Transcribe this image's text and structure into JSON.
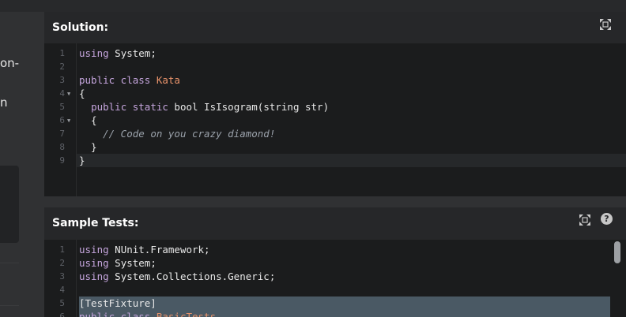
{
  "left": {
    "text1": "on-",
    "text2": "n"
  },
  "solution": {
    "title": "Solution:",
    "expand_icon": "expand-icon",
    "lines": [
      {
        "n": "1",
        "fold": false,
        "segs": [
          {
            "c": "kw",
            "t": "using"
          },
          {
            "c": "",
            "t": " System;"
          }
        ]
      },
      {
        "n": "2",
        "fold": false,
        "segs": []
      },
      {
        "n": "3",
        "fold": false,
        "segs": [
          {
            "c": "kw",
            "t": "public class"
          },
          {
            "c": "",
            "t": " "
          },
          {
            "c": "ty",
            "t": "Kata"
          }
        ]
      },
      {
        "n": "4",
        "fold": true,
        "segs": [
          {
            "c": "",
            "t": "{"
          }
        ]
      },
      {
        "n": "5",
        "fold": false,
        "segs": [
          {
            "c": "",
            "t": "  "
          },
          {
            "c": "kw",
            "t": "public static"
          },
          {
            "c": "",
            "t": " bool IsIsogram(string str)"
          }
        ]
      },
      {
        "n": "6",
        "fold": true,
        "segs": [
          {
            "c": "",
            "t": "  {"
          }
        ]
      },
      {
        "n": "7",
        "fold": false,
        "segs": [
          {
            "c": "",
            "t": "    "
          },
          {
            "c": "cm",
            "t": "// Code on you crazy diamond!"
          }
        ]
      },
      {
        "n": "8",
        "fold": false,
        "segs": [
          {
            "c": "",
            "t": "  }"
          }
        ]
      },
      {
        "n": "9",
        "fold": false,
        "segs": [
          {
            "c": "",
            "t": "}"
          }
        ]
      }
    ]
  },
  "tests": {
    "title": "Sample Tests:",
    "expand_icon": "expand-icon",
    "help_label": "?",
    "lines": [
      {
        "n": "1",
        "fold": false,
        "segs": [
          {
            "c": "kw",
            "t": "using"
          },
          {
            "c": "",
            "t": " NUnit.Framework;"
          }
        ]
      },
      {
        "n": "2",
        "fold": false,
        "segs": [
          {
            "c": "kw",
            "t": "using"
          },
          {
            "c": "",
            "t": " System;"
          }
        ]
      },
      {
        "n": "3",
        "fold": false,
        "segs": [
          {
            "c": "kw",
            "t": "using"
          },
          {
            "c": "",
            "t": " System.Collections.Generic;"
          }
        ]
      },
      {
        "n": "4",
        "fold": false,
        "segs": []
      },
      {
        "n": "5",
        "fold": false,
        "segs": [
          {
            "c": "",
            "t": "[TestFixture]"
          }
        ]
      },
      {
        "n": "6",
        "fold": false,
        "segs": [
          {
            "c": "kw",
            "t": "public class"
          },
          {
            "c": "",
            "t": " "
          },
          {
            "c": "ty",
            "t": "BasicTests"
          }
        ]
      }
    ]
  }
}
